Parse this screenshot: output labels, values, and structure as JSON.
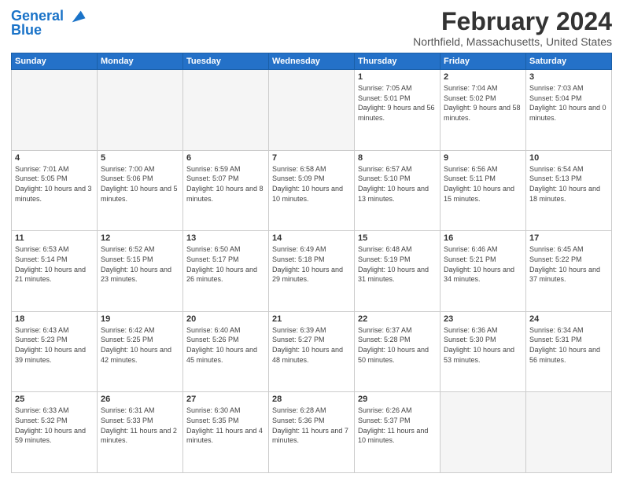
{
  "header": {
    "logo": {
      "line1": "General",
      "line2": "Blue"
    },
    "month": "February 2024",
    "location": "Northfield, Massachusetts, United States"
  },
  "weekdays": [
    "Sunday",
    "Monday",
    "Tuesday",
    "Wednesday",
    "Thursday",
    "Friday",
    "Saturday"
  ],
  "weeks": [
    [
      {
        "day": "",
        "sunrise": "",
        "sunset": "",
        "daylight": "",
        "empty": true
      },
      {
        "day": "",
        "sunrise": "",
        "sunset": "",
        "daylight": "",
        "empty": true
      },
      {
        "day": "",
        "sunrise": "",
        "sunset": "",
        "daylight": "",
        "empty": true
      },
      {
        "day": "",
        "sunrise": "",
        "sunset": "",
        "daylight": "",
        "empty": true
      },
      {
        "day": "1",
        "sunrise": "Sunrise: 7:05 AM",
        "sunset": "Sunset: 5:01 PM",
        "daylight": "Daylight: 9 hours and 56 minutes.",
        "empty": false
      },
      {
        "day": "2",
        "sunrise": "Sunrise: 7:04 AM",
        "sunset": "Sunset: 5:02 PM",
        "daylight": "Daylight: 9 hours and 58 minutes.",
        "empty": false
      },
      {
        "day": "3",
        "sunrise": "Sunrise: 7:03 AM",
        "sunset": "Sunset: 5:04 PM",
        "daylight": "Daylight: 10 hours and 0 minutes.",
        "empty": false
      }
    ],
    [
      {
        "day": "4",
        "sunrise": "Sunrise: 7:01 AM",
        "sunset": "Sunset: 5:05 PM",
        "daylight": "Daylight: 10 hours and 3 minutes.",
        "empty": false
      },
      {
        "day": "5",
        "sunrise": "Sunrise: 7:00 AM",
        "sunset": "Sunset: 5:06 PM",
        "daylight": "Daylight: 10 hours and 5 minutes.",
        "empty": false
      },
      {
        "day": "6",
        "sunrise": "Sunrise: 6:59 AM",
        "sunset": "Sunset: 5:07 PM",
        "daylight": "Daylight: 10 hours and 8 minutes.",
        "empty": false
      },
      {
        "day": "7",
        "sunrise": "Sunrise: 6:58 AM",
        "sunset": "Sunset: 5:09 PM",
        "daylight": "Daylight: 10 hours and 10 minutes.",
        "empty": false
      },
      {
        "day": "8",
        "sunrise": "Sunrise: 6:57 AM",
        "sunset": "Sunset: 5:10 PM",
        "daylight": "Daylight: 10 hours and 13 minutes.",
        "empty": false
      },
      {
        "day": "9",
        "sunrise": "Sunrise: 6:56 AM",
        "sunset": "Sunset: 5:11 PM",
        "daylight": "Daylight: 10 hours and 15 minutes.",
        "empty": false
      },
      {
        "day": "10",
        "sunrise": "Sunrise: 6:54 AM",
        "sunset": "Sunset: 5:13 PM",
        "daylight": "Daylight: 10 hours and 18 minutes.",
        "empty": false
      }
    ],
    [
      {
        "day": "11",
        "sunrise": "Sunrise: 6:53 AM",
        "sunset": "Sunset: 5:14 PM",
        "daylight": "Daylight: 10 hours and 21 minutes.",
        "empty": false
      },
      {
        "day": "12",
        "sunrise": "Sunrise: 6:52 AM",
        "sunset": "Sunset: 5:15 PM",
        "daylight": "Daylight: 10 hours and 23 minutes.",
        "empty": false
      },
      {
        "day": "13",
        "sunrise": "Sunrise: 6:50 AM",
        "sunset": "Sunset: 5:17 PM",
        "daylight": "Daylight: 10 hours and 26 minutes.",
        "empty": false
      },
      {
        "day": "14",
        "sunrise": "Sunrise: 6:49 AM",
        "sunset": "Sunset: 5:18 PM",
        "daylight": "Daylight: 10 hours and 29 minutes.",
        "empty": false
      },
      {
        "day": "15",
        "sunrise": "Sunrise: 6:48 AM",
        "sunset": "Sunset: 5:19 PM",
        "daylight": "Daylight: 10 hours and 31 minutes.",
        "empty": false
      },
      {
        "day": "16",
        "sunrise": "Sunrise: 6:46 AM",
        "sunset": "Sunset: 5:21 PM",
        "daylight": "Daylight: 10 hours and 34 minutes.",
        "empty": false
      },
      {
        "day": "17",
        "sunrise": "Sunrise: 6:45 AM",
        "sunset": "Sunset: 5:22 PM",
        "daylight": "Daylight: 10 hours and 37 minutes.",
        "empty": false
      }
    ],
    [
      {
        "day": "18",
        "sunrise": "Sunrise: 6:43 AM",
        "sunset": "Sunset: 5:23 PM",
        "daylight": "Daylight: 10 hours and 39 minutes.",
        "empty": false
      },
      {
        "day": "19",
        "sunrise": "Sunrise: 6:42 AM",
        "sunset": "Sunset: 5:25 PM",
        "daylight": "Daylight: 10 hours and 42 minutes.",
        "empty": false
      },
      {
        "day": "20",
        "sunrise": "Sunrise: 6:40 AM",
        "sunset": "Sunset: 5:26 PM",
        "daylight": "Daylight: 10 hours and 45 minutes.",
        "empty": false
      },
      {
        "day": "21",
        "sunrise": "Sunrise: 6:39 AM",
        "sunset": "Sunset: 5:27 PM",
        "daylight": "Daylight: 10 hours and 48 minutes.",
        "empty": false
      },
      {
        "day": "22",
        "sunrise": "Sunrise: 6:37 AM",
        "sunset": "Sunset: 5:28 PM",
        "daylight": "Daylight: 10 hours and 50 minutes.",
        "empty": false
      },
      {
        "day": "23",
        "sunrise": "Sunrise: 6:36 AM",
        "sunset": "Sunset: 5:30 PM",
        "daylight": "Daylight: 10 hours and 53 minutes.",
        "empty": false
      },
      {
        "day": "24",
        "sunrise": "Sunrise: 6:34 AM",
        "sunset": "Sunset: 5:31 PM",
        "daylight": "Daylight: 10 hours and 56 minutes.",
        "empty": false
      }
    ],
    [
      {
        "day": "25",
        "sunrise": "Sunrise: 6:33 AM",
        "sunset": "Sunset: 5:32 PM",
        "daylight": "Daylight: 10 hours and 59 minutes.",
        "empty": false
      },
      {
        "day": "26",
        "sunrise": "Sunrise: 6:31 AM",
        "sunset": "Sunset: 5:33 PM",
        "daylight": "Daylight: 11 hours and 2 minutes.",
        "empty": false
      },
      {
        "day": "27",
        "sunrise": "Sunrise: 6:30 AM",
        "sunset": "Sunset: 5:35 PM",
        "daylight": "Daylight: 11 hours and 4 minutes.",
        "empty": false
      },
      {
        "day": "28",
        "sunrise": "Sunrise: 6:28 AM",
        "sunset": "Sunset: 5:36 PM",
        "daylight": "Daylight: 11 hours and 7 minutes.",
        "empty": false
      },
      {
        "day": "29",
        "sunrise": "Sunrise: 6:26 AM",
        "sunset": "Sunset: 5:37 PM",
        "daylight": "Daylight: 11 hours and 10 minutes.",
        "empty": false
      },
      {
        "day": "",
        "sunrise": "",
        "sunset": "",
        "daylight": "",
        "empty": true
      },
      {
        "day": "",
        "sunrise": "",
        "sunset": "",
        "daylight": "",
        "empty": true
      }
    ]
  ]
}
